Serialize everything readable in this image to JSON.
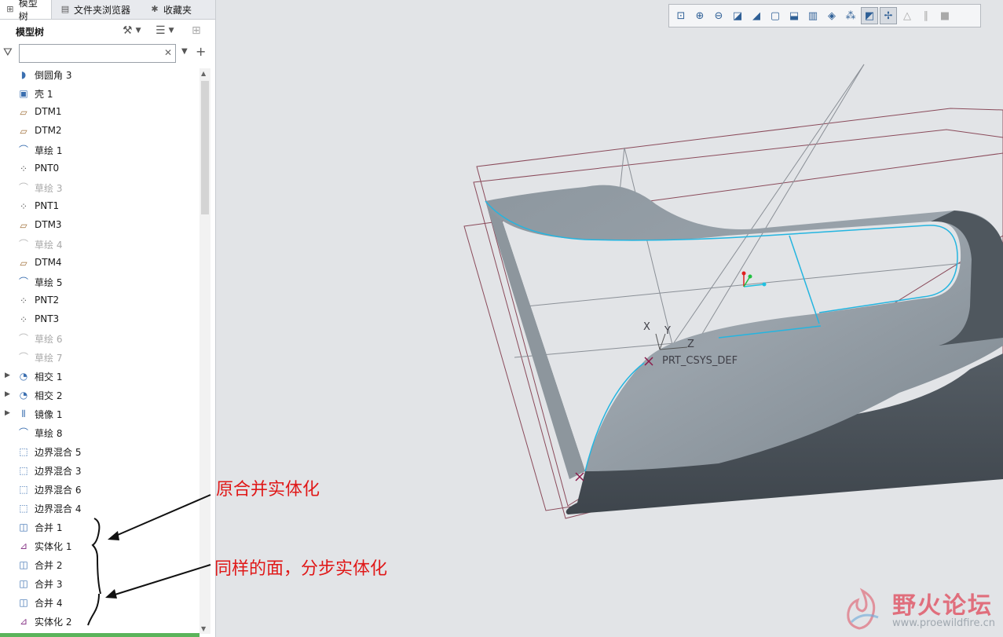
{
  "tabs": [
    {
      "label": "模型树",
      "icon": "tree-icon"
    },
    {
      "label": "文件夹浏览器",
      "icon": "folder-icon"
    },
    {
      "label": "收藏夹",
      "icon": "star-icon"
    }
  ],
  "tree": {
    "title": "模型树",
    "search_value": "",
    "items": [
      {
        "label": "倒圆角 3",
        "icon": "round-icon",
        "suppressed": false,
        "expandable": false
      },
      {
        "label": "壳 1",
        "icon": "shell-icon",
        "suppressed": false,
        "expandable": false
      },
      {
        "label": "DTM1",
        "icon": "datum-plane-icon",
        "suppressed": false,
        "expandable": false
      },
      {
        "label": "DTM2",
        "icon": "datum-plane-icon",
        "suppressed": false,
        "expandable": false
      },
      {
        "label": "草绘 1",
        "icon": "sketch-icon",
        "suppressed": false,
        "expandable": false
      },
      {
        "label": "PNT0",
        "icon": "datum-point-icon",
        "suppressed": false,
        "expandable": false
      },
      {
        "label": "草绘 3",
        "icon": "sketch-icon",
        "suppressed": true,
        "expandable": false
      },
      {
        "label": "PNT1",
        "icon": "datum-point-icon",
        "suppressed": false,
        "expandable": false
      },
      {
        "label": "DTM3",
        "icon": "datum-plane-icon",
        "suppressed": false,
        "expandable": false
      },
      {
        "label": "草绘 4",
        "icon": "sketch-icon",
        "suppressed": true,
        "expandable": false
      },
      {
        "label": "DTM4",
        "icon": "datum-plane-icon",
        "suppressed": false,
        "expandable": false
      },
      {
        "label": "草绘 5",
        "icon": "sketch-icon",
        "suppressed": false,
        "expandable": false
      },
      {
        "label": "PNT2",
        "icon": "datum-point-icon",
        "suppressed": false,
        "expandable": false
      },
      {
        "label": "PNT3",
        "icon": "datum-point-icon",
        "suppressed": false,
        "expandable": false
      },
      {
        "label": "草绘 6",
        "icon": "sketch-icon",
        "suppressed": true,
        "expandable": false
      },
      {
        "label": "草绘 7",
        "icon": "sketch-icon",
        "suppressed": true,
        "expandable": false
      },
      {
        "label": "相交 1",
        "icon": "intersect-icon",
        "suppressed": false,
        "expandable": true
      },
      {
        "label": "相交 2",
        "icon": "intersect-icon",
        "suppressed": false,
        "expandable": true
      },
      {
        "label": "镜像 1",
        "icon": "mirror-icon",
        "suppressed": false,
        "expandable": true
      },
      {
        "label": "草绘 8",
        "icon": "sketch-icon",
        "suppressed": false,
        "expandable": false
      },
      {
        "label": "边界混合 5",
        "icon": "boundary-blend-icon",
        "suppressed": false,
        "expandable": false
      },
      {
        "label": "边界混合 3",
        "icon": "boundary-blend-icon",
        "suppressed": false,
        "expandable": false
      },
      {
        "label": "边界混合 6",
        "icon": "boundary-blend-icon",
        "suppressed": false,
        "expandable": false
      },
      {
        "label": "边界混合 4",
        "icon": "boundary-blend-icon",
        "suppressed": false,
        "expandable": false
      },
      {
        "label": "合并 1",
        "icon": "merge-icon",
        "suppressed": false,
        "expandable": false
      },
      {
        "label": "实体化 1",
        "icon": "solidify-icon",
        "suppressed": false,
        "expandable": false
      },
      {
        "label": "合并 2",
        "icon": "merge-icon",
        "suppressed": false,
        "expandable": false
      },
      {
        "label": "合并 3",
        "icon": "merge-icon",
        "suppressed": false,
        "expandable": false
      },
      {
        "label": "合并 4",
        "icon": "merge-icon",
        "suppressed": false,
        "expandable": false
      },
      {
        "label": "实体化 2",
        "icon": "solidify-icon",
        "suppressed": false,
        "expandable": false
      }
    ]
  },
  "view_toolbar": [
    {
      "icon": "refit-icon",
      "on": false,
      "dim": false
    },
    {
      "icon": "zoom-in-icon",
      "on": false,
      "dim": false
    },
    {
      "icon": "zoom-out-icon",
      "on": false,
      "dim": false
    },
    {
      "icon": "repaint-icon",
      "on": false,
      "dim": false
    },
    {
      "icon": "perspective-icon",
      "on": false,
      "dim": false
    },
    {
      "icon": "display-style-icon",
      "on": false,
      "dim": false
    },
    {
      "icon": "saved-views-icon",
      "on": false,
      "dim": false
    },
    {
      "icon": "view-manager-icon",
      "on": false,
      "dim": false
    },
    {
      "icon": "section-icon",
      "on": false,
      "dim": false
    },
    {
      "icon": "datum-display-icon",
      "on": false,
      "dim": false
    },
    {
      "icon": "annotation-display-icon",
      "on": true,
      "dim": false
    },
    {
      "icon": "spin-center-icon",
      "on": true,
      "dim": false
    },
    {
      "icon": "animation-icon",
      "on": false,
      "dim": true
    },
    {
      "icon": "pause-icon",
      "on": false,
      "dim": true
    },
    {
      "icon": "stop-icon",
      "on": false,
      "dim": true
    }
  ],
  "viewport": {
    "csys_label": "PRT_CSYS_DEF",
    "axis_x": "X",
    "axis_y": "Y",
    "axis_z": "Z"
  },
  "annotations": {
    "original": "原合并实体化",
    "stepwise": "同样的面，分步实体化"
  },
  "watermark": {
    "title": "野火论坛",
    "url": "www.proewildfire.cn"
  },
  "colors": {
    "annotation_red": "#e01818",
    "surface_gray": "#7e8891",
    "edge_cyan": "#24b5e0",
    "datum_maroon": "#7a2a3a"
  }
}
